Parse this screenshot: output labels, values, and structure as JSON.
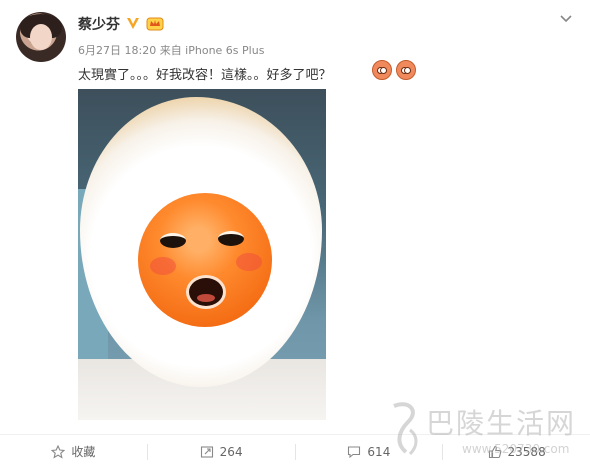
{
  "post": {
    "author": "蔡少芬",
    "meta": "6月27日 18:20 来自 iPhone 6s Plus",
    "text": "太現實了。。。好我改容！這樣。。好多了吧？"
  },
  "actions": {
    "favorite_label": "收藏",
    "repost_count": "264",
    "comment_count": "614",
    "like_count": "23588"
  },
  "watermark": {
    "text": "巴陵生活网",
    "url": "www.520730.com"
  },
  "icons": [
    "verified-v-icon",
    "vip-crown-icon",
    "chevron-down-icon",
    "star-icon",
    "repost-icon",
    "comment-icon",
    "like-icon",
    "emoji-icon"
  ],
  "colors": {
    "verified": "#f5a623",
    "text": "#333333",
    "meta": "#888888"
  }
}
